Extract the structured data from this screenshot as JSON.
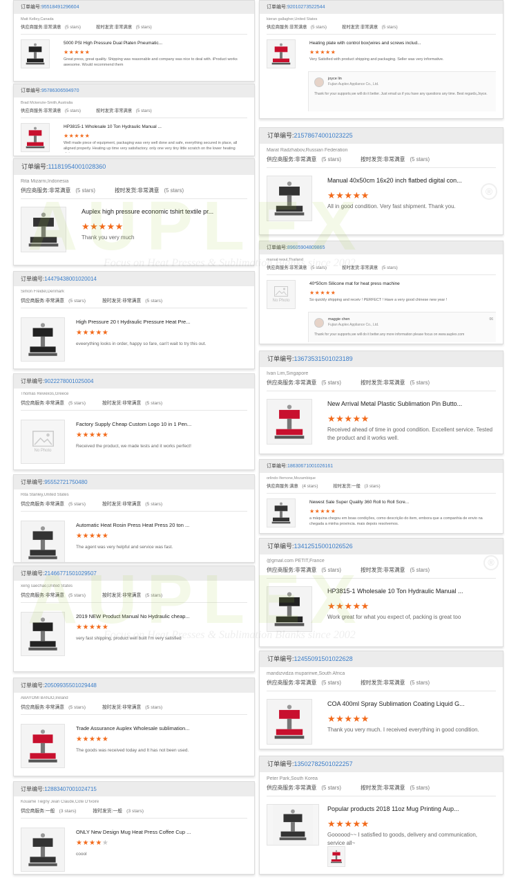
{
  "labels": {
    "order_prefix": "订单编号:",
    "service_label": "供应商服务:",
    "shipping_label": "按时发货:",
    "no_photo": "No Photo"
  },
  "colors": {
    "accent_link": "#3a7dc9",
    "star": "#f26a1b",
    "header_bg": "#ececec"
  },
  "watermark": {
    "brand": "AUPLEX",
    "tagline": "Focus on Heat Presses & Sublimation Blanks since 2002",
    "registered": "®"
  },
  "reviews_left": [
    {
      "order": "95518491296604",
      "buyer": "Matt Kelley,Canada",
      "service": "非常满意",
      "service_stars": "(5 stars)",
      "shipping": "非常满意",
      "shipping_stars": "(5 stars)",
      "title": "5000 PSI High Pressure Dual Platen Pneumatic...",
      "stars": 5,
      "comment": "Great press, great quality. Shipping was reasonable and company was nice to deal with. iProduct works awesome. Would recommend them"
    },
    {
      "order": "95786306594970",
      "buyer": "Brad Mckenzie-Smith,Australia",
      "service": "非常满意",
      "service_stars": "(5 stars)",
      "shipping": "非常满意",
      "shipping_stars": "(5 stars)",
      "title": "HP3815-1 Wholesale 10 Ton Hydraulic Manual ...",
      "stars": 5,
      "comment": "Well made piece of equipment, packaging was very well done and safe, everything secured in place, all aligned properly. Heating up time very satisfactory. only one very tiny little scratch on the lower heating plate"
    },
    {
      "order": "11181954001028360",
      "buyer": "Rita Mizarni,Indonesia",
      "service": "非常满意",
      "service_stars": "(5 stars)",
      "shipping": "非常满意",
      "shipping_stars": "(5 stars)",
      "title": "Auplex high pressure economic tshirt textile pr...",
      "stars": 5,
      "comment": "Thank you very much"
    },
    {
      "order": "14479438001020014",
      "buyer": "Simon Freidel,Denmark",
      "service": "非常满意",
      "service_stars": "(5 stars)",
      "shipping": "非常满意",
      "shipping_stars": "(5 stars)",
      "title": "High Pressure 20 t Hydraulic Pressure Heat Pre...",
      "stars": 5,
      "comment": "eveerything looks in order, happy so fare, can't wait to try this out."
    },
    {
      "order": "9022278001025004",
      "buyer": "Thomas Reviexos,Greece",
      "service": "非常满意",
      "service_stars": "(5 stars)",
      "shipping": "非常满意",
      "shipping_stars": "(5 stars)",
      "title": "Factory Supply Cheap Custom Logo 10 in 1 Pen...",
      "stars": 5,
      "comment": "Received the product, we made tests and it works perfect!"
    },
    {
      "order": "95552721750480",
      "buyer": "Rita Stanley,United States",
      "service": "非常满意",
      "service_stars": "(5 stars)",
      "shipping": "非常满意",
      "shipping_stars": "(5 stars)",
      "title": "Automatic Heat Rosin Press Heat Press 20 ton ...",
      "stars": 5,
      "comment": "The agent was very helpful and service was fast."
    },
    {
      "order": "21466771501029507",
      "buyer": "xeng saechao,United States",
      "service": "非常满意",
      "service_stars": "(5 stars)",
      "shipping": "非常满意",
      "shipping_stars": "(5 stars)",
      "title": "2019 NEW Product Manual No Hydraulic cheap...",
      "stars": 5,
      "comment": "very fast shipping, product well built I'm very satisfied"
    },
    {
      "order": "20509935501029448",
      "buyer": "ABAYOMI BANJO,Ireland",
      "service": "非常满意",
      "service_stars": "(5 stars)",
      "shipping": "非常满意",
      "shipping_stars": "(5 stars)",
      "title": "Trade Assurance Auplex Wholesale sublimation...",
      "stars": 5,
      "comment": "The goods was received today and It has not been used."
    },
    {
      "order": "12883407001024715",
      "buyer": "Kouame Tiegny Jean Claude,Cote D'Ivoire",
      "service": "一般",
      "service_stars": "(3 stars)",
      "shipping": "一般",
      "shipping_stars": "(3 stars)",
      "title": "ONLY New Design Mug Heat Press Coffee Cup ...",
      "stars": 4,
      "comment": "coool"
    }
  ],
  "reviews_right": [
    {
      "order": "92010273522544",
      "buyer": "kieran gallagher,United States",
      "service": "非常满意",
      "service_stars": "(5 stars)",
      "shipping": "非常满意",
      "shipping_stars": "(5 stars)",
      "title": "Heating plate with control box(wires and screws includ...",
      "stars": 5,
      "comment": "Very Satisfied with product shipping and packaging. Seller was very informative.",
      "reply": {
        "name": "joyce lin",
        "company": "Fujian Auplex Appliance Co., Ltd.",
        "text": "Thank for your supports,we will do it better. Just email us if you have any questions any time. Best regards,Joyce."
      }
    },
    {
      "order": "21578674001023225",
      "buyer": "Marat Radzhabov,Russian Federation",
      "service": "非常满意",
      "service_stars": "(5 stars)",
      "shipping": "非常满意",
      "shipping_stars": "(5 stars)",
      "title": "Manual 40x50cm 16x20 inch flatbed digital con...",
      "stars": 5,
      "comment": "All in good condition. Very fast shipment. Thank you."
    },
    {
      "order": "89605904809865",
      "buyer": "marsal reoul,Thailand",
      "service": "非常满意",
      "service_stars": "(5 stars)",
      "shipping": "非常满意",
      "shipping_stars": "(5 stars)",
      "title": "40*50cm Silicone mat for heat press machine",
      "stars": 5,
      "comment": "So quickly shipping and receiv ! PERFECT ! Have a very good chinese new year !",
      "reply": {
        "name": "maggie chen",
        "company": "Fujian Auplex Appliance Co., Ltd.",
        "date": "06",
        "text": "Thank for your supports,we will do it better.any more information please focus on www.auplex.com"
      }
    },
    {
      "order": "13673531501023189",
      "buyer": "Ivan Lim,Singapore",
      "service": "非常满意",
      "service_stars": "(5 stars)",
      "shipping": "非常满意",
      "shipping_stars": "(5 stars)",
      "title": "New Arrival Metal Plastic Sublimation Pin Butto...",
      "stars": 5,
      "comment": "Received ahead of time in good condition. Excellent service. Tested the product and it works well."
    },
    {
      "order": "18630671001026161",
      "buyer": "orlindo Ifemone,Mozambique",
      "service": "满意",
      "service_stars": "(4 stars)",
      "shipping": "一般",
      "shipping_stars": "(3 stars)",
      "title": "Newest Sale Super Quality 360 Roll to Roll Scre...",
      "stars": 5,
      "comment": "a máquina chegou em boas condições, como descrição do item, embora que a companhia de envio na chegada a minha provincia. mais depois resolvemos."
    },
    {
      "order": "13412515001026526",
      "buyer": "@gmail.com PETIT,France",
      "service": "非常满意",
      "service_stars": "(5 stars)",
      "shipping": "非常满意",
      "shipping_stars": "(5 stars)",
      "title": "HP3815-1 Wholesale 10 Ton Hydraulic Manual ...",
      "stars": 5,
      "comment": "Work great for what you expect of, packing is great too"
    },
    {
      "order": "12455091501022628",
      "buyer": "mandizvidza muparirwe,South Africa",
      "service": "非常满意",
      "service_stars": "(5 stars)",
      "shipping": "非常满意",
      "shipping_stars": "(5 stars)",
      "title": "COA 400ml Spray Sublimation Coating Liquid G...",
      "stars": 5,
      "comment": "Thank you very much. I received everything in good condition."
    },
    {
      "order": "13502782501022257",
      "buyer": "Peter Park,South Korea",
      "service": "非常满意",
      "service_stars": "(5 stars)",
      "shipping": "非常满意",
      "shipping_stars": "(5 stars)",
      "title": "Popular products 2018 11oz Mug Printing Aup...",
      "stars": 5,
      "comment": "Goooood~~ I satisfied to goods, delivery and communication, service all~"
    }
  ]
}
